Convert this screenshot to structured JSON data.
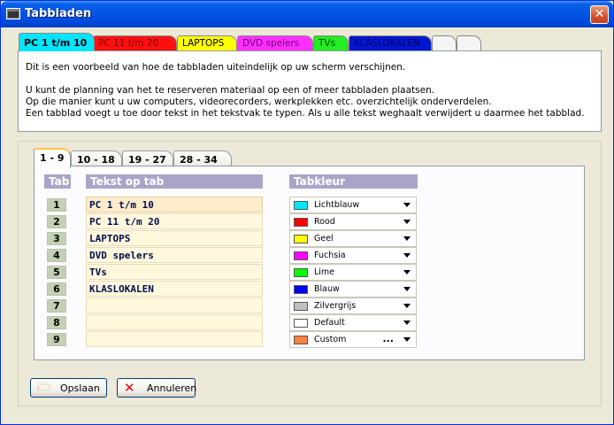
{
  "window": {
    "title": "Tabbladen",
    "close_glyph": "✕"
  },
  "top_tabs": [
    {
      "label": "PC 1 t/m 10",
      "color": "#00e5ff",
      "text_color": "#000"
    },
    {
      "label": "PC 11 t/m 20",
      "color": "#ff1010",
      "text_color": "#7a0000"
    },
    {
      "label": "LAPTOPS",
      "color": "#ffff00",
      "text_color": "#000"
    },
    {
      "label": "DVD spelers",
      "color": "#ff30ff",
      "text_color": "#6a006a"
    },
    {
      "label": "TVs",
      "color": "#22ee22",
      "text_color": "#004400"
    },
    {
      "label": "KLASLOKALEN",
      "color": "#0018d0",
      "text_color": "#000060"
    },
    {
      "label": "",
      "color": "#f4f4f4",
      "text_color": "#000"
    },
    {
      "label": "",
      "color": "#f4f4f4",
      "text_color": "#000"
    }
  ],
  "info": {
    "line1": "Dit is een voorbeeld van hoe de tabbladen uiteindelijk op uw scherm verschijnen.",
    "line2": "U kunt de planning van het te reserveren materiaal op een of meer tabbladen plaatsen.",
    "line3": "Op die manier kunt u uw computers, videorecorders, werkplekken etc. overzichtelijk onderverdelen.",
    "line4": "Een tabblad voegt u toe door tekst in het tekstvak te typen. Als u alle tekst weghaalt verwijdert u daarmee het tabblad."
  },
  "sub_tabs": [
    "1 - 9",
    "10 - 18",
    "19 - 27",
    "28 - 34"
  ],
  "headers": {
    "tab": "Tab",
    "text": "Tekst op tab",
    "color": "Tabkleur"
  },
  "rows": [
    {
      "num": "1",
      "text": "PC 1 t/m 10",
      "color_name": "Lichtblauw",
      "swatch": "#00e5ff"
    },
    {
      "num": "2",
      "text": "PC 11 t/m 20",
      "color_name": "Rood",
      "swatch": "#ff0000"
    },
    {
      "num": "3",
      "text": "LAPTOPS",
      "color_name": "Geel",
      "swatch": "#ffff00"
    },
    {
      "num": "4",
      "text": "DVD spelers",
      "color_name": "Fuchsia",
      "swatch": "#ff00ff"
    },
    {
      "num": "5",
      "text": "TVs",
      "color_name": "Lime",
      "swatch": "#00ff00"
    },
    {
      "num": "6",
      "text": "KLASLOKALEN",
      "color_name": "Blauw",
      "swatch": "#0000ff"
    },
    {
      "num": "7",
      "text": "",
      "color_name": "Zilvergrijs",
      "swatch": "#c0c0c0"
    },
    {
      "num": "8",
      "text": "",
      "color_name": "Default",
      "swatch": "#ffffff"
    },
    {
      "num": "9",
      "text": "",
      "color_name": "Custom",
      "swatch": "#ff8040",
      "dots": "..."
    }
  ],
  "buttons": {
    "save": {
      "label": "Opslaan",
      "icon": "folder-icon"
    },
    "cancel": {
      "label": "Annuleren",
      "icon": "cross-icon"
    }
  }
}
